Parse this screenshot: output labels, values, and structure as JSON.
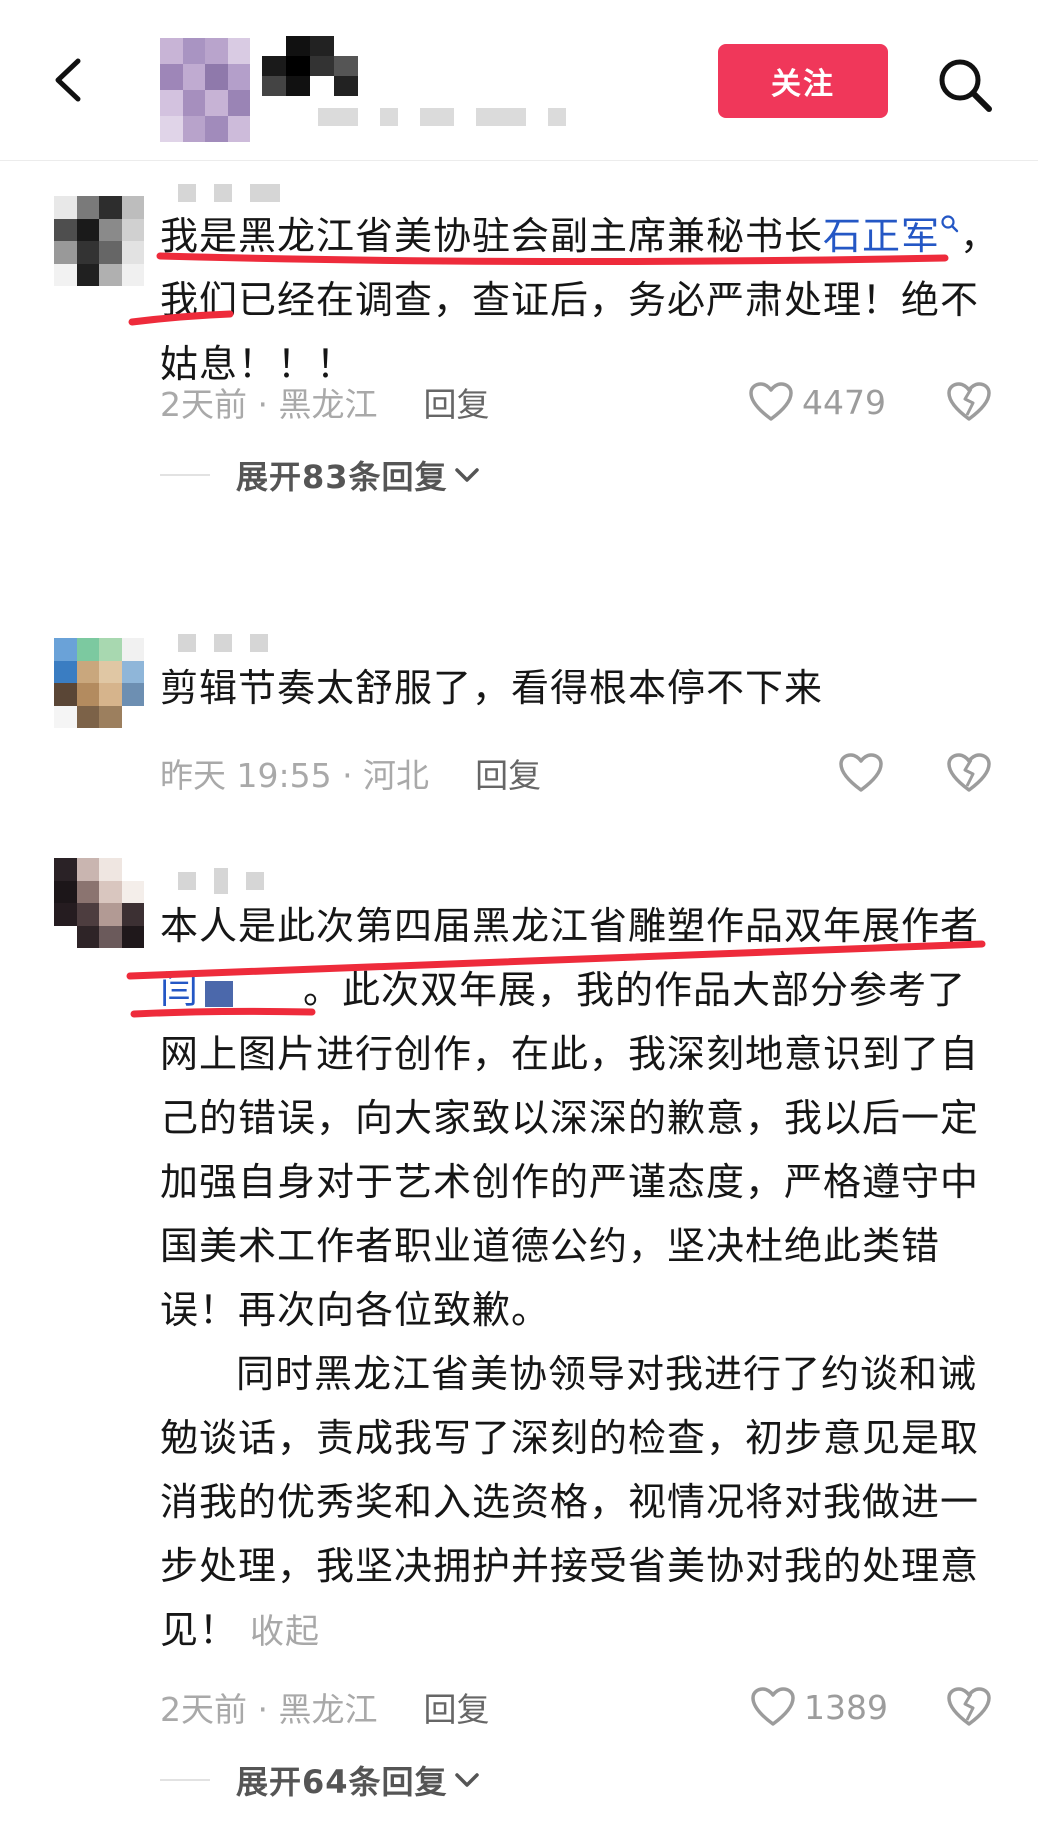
{
  "header": {
    "follow_label": "关注",
    "back_icon": "chevron-left-icon",
    "search_icon": "search-icon",
    "accent_color": "#f0375a"
  },
  "comments": [
    {
      "text_before": "我是黑龙江省美协驻会副主席兼秘书长",
      "link": "石正军",
      "text_after": "，我们已经在调查，查证后，务必严肃处理！绝不姑息！！！",
      "time": "2天前 · 黑龙江",
      "reply": "回复",
      "likes": "4479",
      "expand": "展开83条回复"
    },
    {
      "text": "剪辑节奏太舒服了，看得根本停不下来",
      "time": "昨天 19:55 · 河北",
      "reply": "回复"
    },
    {
      "text_before": "本人是此次第四届黑龙江省雕塑作品双年展作者",
      "link": "闫",
      "text_after": "。此次双年展，我的作品大部分参考了网上图片进行创作，在此，我深刻地意识到了自己的错误，向大家致以深深的歉意，我以后一定加强自身对于艺术创作的严谨态度，严格遵守中国美术工作者职业道德公约，坚决杜绝此类错误！再次向各位致歉。",
      "text_para2": "同时黑龙江省美协领导对我进行了约谈和诫勉谈话，责成我写了深刻的检查，初步意见是取消我的优秀奖和入选资格，视情况将对我做进一步处理，我坚决拥护并接受省美协对我的处理意见！",
      "collapse": "收起",
      "time": "2天前 · 黑龙江",
      "reply": "回复",
      "likes": "1389",
      "expand": "展开64条回复"
    }
  ],
  "colors": {
    "underline_red": "#ee2b3b",
    "link_blue": "#2457c5",
    "meta_gray": "#a9a9a9"
  }
}
